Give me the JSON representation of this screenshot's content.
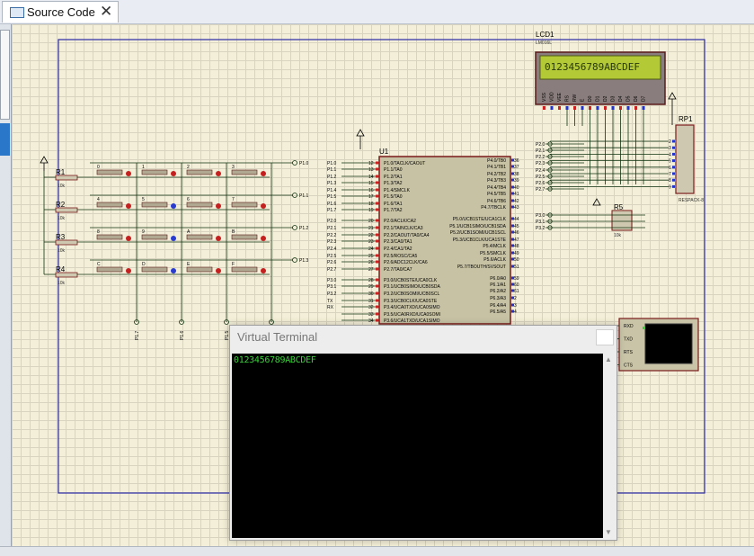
{
  "tab": {
    "label": "Source Code",
    "close": "✕"
  },
  "lcd": {
    "ref": "LCD1",
    "part": "LM016L",
    "display": "0123456789ABCDEF",
    "pins": [
      "VSS",
      "VDD",
      "VEE",
      "RS",
      "RW",
      "E",
      "D0",
      "D1",
      "D2",
      "D3",
      "D4",
      "D5",
      "D6",
      "D7"
    ]
  },
  "rp1": {
    "ref": "RP1",
    "part": "RESPACK-8"
  },
  "r5": {
    "ref": "R5",
    "value": "10k"
  },
  "u1": {
    "ref": "U1",
    "left_pins": [
      "P1.0/TACLK/CAOUT",
      "P1.1/TA0",
      "P1.2/TA1",
      "P1.3/TA2",
      "P1.4/SMCLK",
      "P1.5/TA0",
      "P1.6/TA1",
      "P1.7/TA2",
      "P2.0/ACLK/CA2",
      "P2.1/TAINCLK/CA3",
      "P2.2/CAOUT/TA0/CA4",
      "P2.3/CA0/TA1",
      "P2.4/CA1/TA2",
      "P2.5/ROSC/CA5",
      "P2.6/ADC12CLK/CA6",
      "P2.7/TA0/CA7",
      "P3.0/UCB0STE/UCA0CLK",
      "P3.1/UCB0SIMO/UCB0SDA",
      "P3.2/UCB0SOMI/UCB0SCL",
      "P3.3/UCB0CLK/UCA0STE",
      "P3.4/UCA0TXD/UCA0SIMO",
      "P3.5/UCA0RXD/UCA0SOMI",
      "P3.6/UCA1TXD/UCA1SIMO"
    ],
    "left_nums": [
      "12",
      "13",
      "14",
      "15",
      "16",
      "17",
      "18",
      "19",
      "20",
      "21",
      "22",
      "23",
      "24",
      "25",
      "26",
      "27",
      "28",
      "29",
      "30",
      "31",
      "32",
      "33",
      "34"
    ],
    "right_pins": [
      "P4.0/TB0",
      "P4.1/TB1",
      "P4.2/TB2",
      "P4.3/TB3",
      "P4.4/TB4",
      "P4.5/TB5",
      "P4.6/TB6",
      "P4.7/TBCLK",
      "P5.0/UCB1STE/UCA1CLK",
      "P5.1/UCB1SIMO/UCB1SDA",
      "P5.2/UCB1SOMI/UCB1SCL",
      "P5.3/UCB1CLK/UCA1STE",
      "P5.4/MCLK",
      "P5.5/SMCLK",
      "P5.6/ACLK",
      "P5.7/TBOUTH/SVSOUT",
      "P6.0/A0",
      "P6.1/A1",
      "P6.2/A2",
      "P6.3/A3",
      "P6.4/A4",
      "P6.5/A5"
    ],
    "right_nums": [
      "36",
      "37",
      "38",
      "39",
      "40",
      "41",
      "42",
      "43",
      "44",
      "45",
      "46",
      "47",
      "48",
      "49",
      "50",
      "51",
      "59",
      "60",
      "61",
      "2",
      "3",
      "4"
    ]
  },
  "net_left": [
    "P1.0",
    "P1.1",
    "P1.2",
    "P1.3",
    "P1.4",
    "P1.5",
    "P1.6",
    "P1.7",
    "P2.0",
    "P2.1",
    "P2.2",
    "P2.3",
    "P2.4",
    "P2.5",
    "P2.6",
    "P2.7",
    "P3.0",
    "P3.1",
    "P3.2",
    "TX",
    "RX"
  ],
  "net_right": [
    "P2.0",
    "P2.1",
    "P2.2",
    "P2.3",
    "P2.4",
    "P2.5",
    "P2.6",
    "P2.7",
    "P3.0",
    "P3.1",
    "P3.2"
  ],
  "row_resistors": [
    {
      "ref": "R1",
      "value": "10k"
    },
    {
      "ref": "R2",
      "value": "10k"
    },
    {
      "ref": "R3",
      "value": "10k"
    },
    {
      "ref": "R4",
      "value": "10k"
    }
  ],
  "row_nets": [
    "P1.0",
    "P1.1",
    "P1.2",
    "P1.3"
  ],
  "keys": [
    [
      "0",
      "1",
      "2",
      "3"
    ],
    [
      "4",
      "5",
      "6",
      "7"
    ],
    [
      "8",
      "9",
      "A",
      "B"
    ],
    [
      "C",
      "D",
      "E",
      "F"
    ]
  ],
  "col_nets": [
    "P1.7",
    "P1.6",
    "P1.5",
    "P1.4"
  ],
  "rp1_pins": [
    "2",
    "3",
    "4",
    "5",
    "6",
    "7",
    "8",
    "9"
  ],
  "vterm": {
    "title": "Virtual Terminal",
    "close": "✕",
    "output": "0123456789ABCDEF",
    "pins": [
      "RXD",
      "TXD",
      "RTS",
      "CTS"
    ]
  }
}
